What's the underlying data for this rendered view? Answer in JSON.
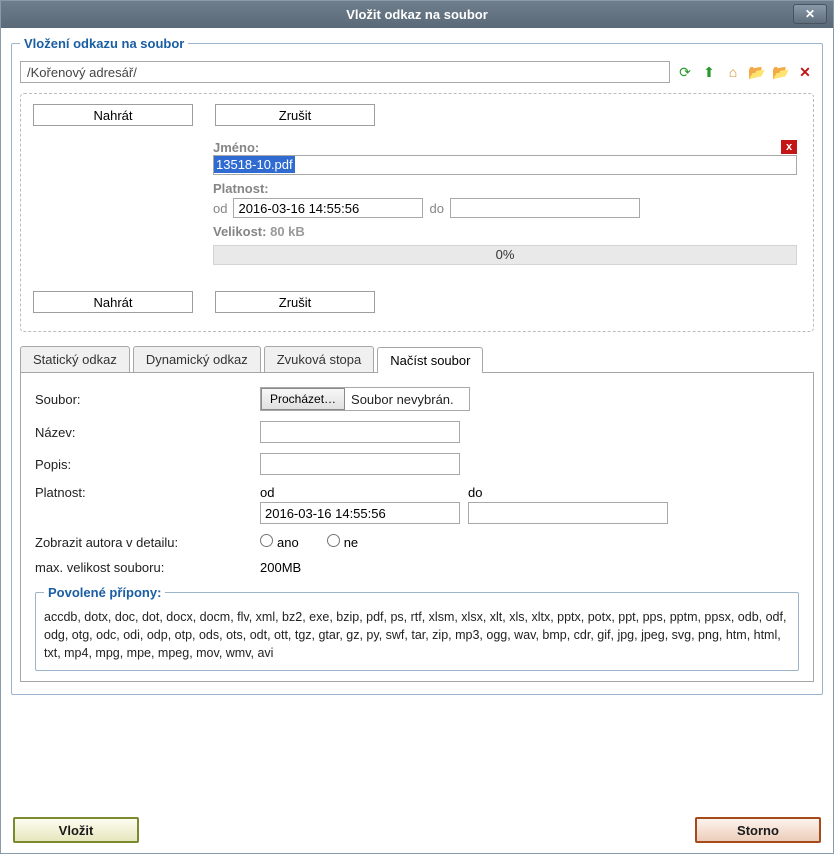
{
  "title": "Vložit odkaz na soubor",
  "fieldset_title": "Vložení odkazu na soubor",
  "path": "/Kořenový adresář/",
  "icons": {
    "refresh": "↻",
    "up": "↑",
    "home": "⌂",
    "folder": "📁",
    "newfolder": "📁",
    "delete": "✕"
  },
  "upload": {
    "btn_upload": "Nahrát",
    "btn_cancel": "Zrušit",
    "name_label": "Jméno:",
    "filename": "13518-10.pdf",
    "validity_label": "Platnost:",
    "od": "od",
    "od_val": "2016-03-16 14:55:56",
    "do": "do",
    "do_val": "",
    "size_label": "Velikost:",
    "size_val": "80 kB",
    "progress": "0%"
  },
  "tabs": {
    "t1": "Statický odkaz",
    "t2": "Dynamický odkaz",
    "t3": "Zvuková stopa",
    "t4": "Načíst soubor"
  },
  "form": {
    "file_label": "Soubor:",
    "browse": "Procházet…",
    "nofile": "Soubor nevybrán.",
    "name_label": "Název:",
    "desc_label": "Popis:",
    "valid_label": "Platnost:",
    "od": "od",
    "od_val": "2016-03-16 14:55:56",
    "do": "do",
    "do_val": "",
    "author_label": "Zobrazit autora v detailu:",
    "yes": "ano",
    "no": "ne",
    "max_label": "max. velikost souboru:",
    "max_val": "200MB"
  },
  "ext": {
    "legend": "Povolené přípony:",
    "list": "accdb, dotx, doc, dot, docx, docm, flv, xml, bz2, exe, bzip, pdf, ps, rtf, xlsm, xlsx, xlt, xls, xltx, pptx, potx, ppt, pps, pptm, ppsx, odb, odf, odg, otg, odc, odi, odp, otp, ods, ots, odt, ott, tgz, gtar, gz, py, swf, tar, zip, mp3, ogg, wav, bmp, cdr, gif, jpg, jpeg, svg, png, htm, html, txt, mp4, mpg, mpe, mpeg, mov, wmv, avi"
  },
  "footer": {
    "insert": "Vložit",
    "cancel": "Storno"
  }
}
